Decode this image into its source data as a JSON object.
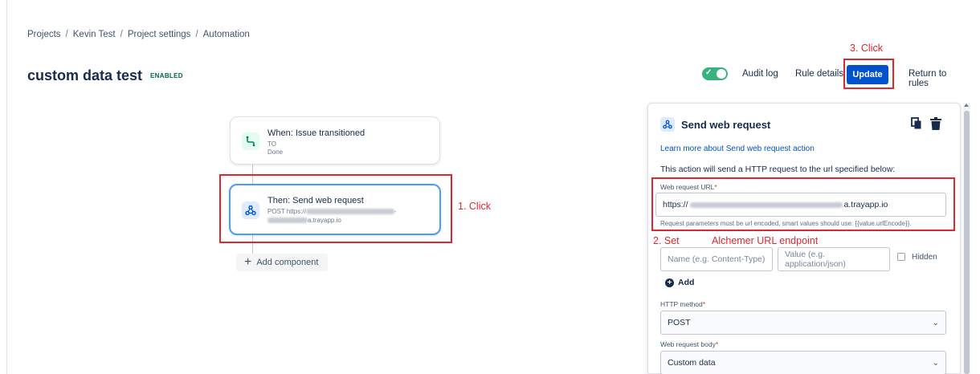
{
  "breadcrumb": [
    "Projects",
    "Kevin Test",
    "Project settings",
    "Automation"
  ],
  "breadcrumb_separator": "/",
  "header": {
    "title": "custom data test",
    "status": "ENABLED",
    "status_color": "#006644",
    "enabled_toggle": true,
    "audit_log": "Audit log",
    "rule_details": "Rule details",
    "update": "Update",
    "return_to_rules": "Return to rules"
  },
  "canvas": {
    "trigger": {
      "title": "When: Issue transitioned",
      "line1": "TO",
      "line2": "Done"
    },
    "action": {
      "title": "Then: Send web request",
      "line1_prefix": "POST https://",
      "line1_suffix": "-",
      "line2_suffix": "a.trayapp.io"
    },
    "add_component": "Add component"
  },
  "annotations": {
    "step1": "1. Click",
    "step2": "2. Set",
    "step2_detail": "Alchemer URL endpoint",
    "step3": "3. Click",
    "color": "#e0262e"
  },
  "panel": {
    "title": "Send web request",
    "learn_more": "Learn more about Send web request action",
    "description": "This action will send a HTTP request to the url specified below:",
    "url_label": "Web request URL",
    "url_prefix": "https://",
    "url_suffix": "a.trayapp.io",
    "url_help": "Request parameters must be url encoded, smart values should use: {{value.urlEncode}}.",
    "header_name_placeholder": "Name (e.g. Content-Type)",
    "header_value_placeholder": "Value (e.g. application/json)",
    "hidden_label": "Hidden",
    "add_label": "Add",
    "method_label": "HTTP method",
    "method_value": "POST",
    "body_label": "Web request body",
    "body_value": "Custom data",
    "required_mark": "*"
  },
  "icons": {
    "trigger": "trigger-branch-icon",
    "webhook": "webhook-icon",
    "copy": "copy-icon",
    "delete": "trash-icon",
    "add": "plus-icon",
    "dropdown": "chevron-down-icon"
  },
  "colors": {
    "primary": "#0052cc",
    "toggle_on": "#36b37e",
    "focus": "#4c9aff"
  }
}
